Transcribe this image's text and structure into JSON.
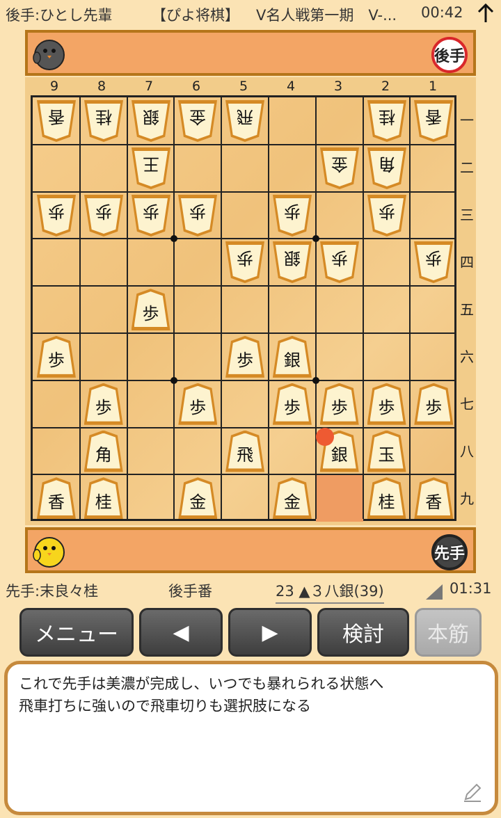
{
  "header": {
    "gote_player": "後手:ひとし先輩",
    "app_name": "【ぴよ将棋】",
    "game_name": "V名人戦第一期　V-...",
    "clock": "00:42"
  },
  "gote_badge": "後手",
  "sente_badge": "先手",
  "file_labels": [
    "9",
    "8",
    "7",
    "6",
    "5",
    "4",
    "3",
    "2",
    "1"
  ],
  "rank_labels": [
    "一",
    "二",
    "三",
    "四",
    "五",
    "六",
    "七",
    "八",
    "九"
  ],
  "board": [
    {
      "file": 9,
      "rank": 1,
      "kanji": "香",
      "owner": "gote"
    },
    {
      "file": 8,
      "rank": 1,
      "kanji": "桂",
      "owner": "gote"
    },
    {
      "file": 7,
      "rank": 1,
      "kanji": "銀",
      "owner": "gote"
    },
    {
      "file": 6,
      "rank": 1,
      "kanji": "金",
      "owner": "gote"
    },
    {
      "file": 5,
      "rank": 1,
      "kanji": "飛",
      "owner": "gote"
    },
    {
      "file": 2,
      "rank": 1,
      "kanji": "桂",
      "owner": "gote"
    },
    {
      "file": 1,
      "rank": 1,
      "kanji": "香",
      "owner": "gote"
    },
    {
      "file": 7,
      "rank": 2,
      "kanji": "王",
      "owner": "gote"
    },
    {
      "file": 3,
      "rank": 2,
      "kanji": "金",
      "owner": "gote"
    },
    {
      "file": 2,
      "rank": 2,
      "kanji": "角",
      "owner": "gote"
    },
    {
      "file": 9,
      "rank": 3,
      "kanji": "歩",
      "owner": "gote"
    },
    {
      "file": 8,
      "rank": 3,
      "kanji": "歩",
      "owner": "gote"
    },
    {
      "file": 7,
      "rank": 3,
      "kanji": "歩",
      "owner": "gote"
    },
    {
      "file": 6,
      "rank": 3,
      "kanji": "歩",
      "owner": "gote"
    },
    {
      "file": 4,
      "rank": 3,
      "kanji": "歩",
      "owner": "gote"
    },
    {
      "file": 2,
      "rank": 3,
      "kanji": "歩",
      "owner": "gote"
    },
    {
      "file": 5,
      "rank": 4,
      "kanji": "歩",
      "owner": "gote"
    },
    {
      "file": 4,
      "rank": 4,
      "kanji": "銀",
      "owner": "gote"
    },
    {
      "file": 3,
      "rank": 4,
      "kanji": "歩",
      "owner": "gote"
    },
    {
      "file": 1,
      "rank": 4,
      "kanji": "歩",
      "owner": "gote"
    },
    {
      "file": 7,
      "rank": 5,
      "kanji": "歩",
      "owner": "sente"
    },
    {
      "file": 9,
      "rank": 6,
      "kanji": "歩",
      "owner": "sente"
    },
    {
      "file": 5,
      "rank": 6,
      "kanji": "歩",
      "owner": "sente"
    },
    {
      "file": 4,
      "rank": 6,
      "kanji": "銀",
      "owner": "sente"
    },
    {
      "file": 8,
      "rank": 7,
      "kanji": "歩",
      "owner": "sente"
    },
    {
      "file": 6,
      "rank": 7,
      "kanji": "歩",
      "owner": "sente"
    },
    {
      "file": 4,
      "rank": 7,
      "kanji": "歩",
      "owner": "sente"
    },
    {
      "file": 3,
      "rank": 7,
      "kanji": "歩",
      "owner": "sente"
    },
    {
      "file": 2,
      "rank": 7,
      "kanji": "歩",
      "owner": "sente"
    },
    {
      "file": 1,
      "rank": 7,
      "kanji": "歩",
      "owner": "sente"
    },
    {
      "file": 8,
      "rank": 8,
      "kanji": "角",
      "owner": "sente"
    },
    {
      "file": 5,
      "rank": 8,
      "kanji": "飛",
      "owner": "sente"
    },
    {
      "file": 3,
      "rank": 8,
      "kanji": "銀",
      "owner": "sente"
    },
    {
      "file": 2,
      "rank": 8,
      "kanji": "玉",
      "owner": "sente"
    },
    {
      "file": 9,
      "rank": 9,
      "kanji": "香",
      "owner": "sente"
    },
    {
      "file": 8,
      "rank": 9,
      "kanji": "桂",
      "owner": "sente"
    },
    {
      "file": 6,
      "rank": 9,
      "kanji": "金",
      "owner": "sente"
    },
    {
      "file": 4,
      "rank": 9,
      "kanji": "金",
      "owner": "sente"
    },
    {
      "file": 2,
      "rank": 9,
      "kanji": "桂",
      "owner": "sente"
    },
    {
      "file": 1,
      "rank": 9,
      "kanji": "香",
      "owner": "sente"
    }
  ],
  "last_move_from": {
    "file": 3,
    "rank": 9
  },
  "last_move_to": {
    "file": 3,
    "rank": 8
  },
  "info": {
    "sente_player": "先手:末良々桂",
    "turn": "後手番",
    "move": "23 ▲３八銀(39)",
    "clock": "01:31"
  },
  "buttons": {
    "menu": "メニュー",
    "prev": "◀",
    "next": "▶",
    "analyze": "検討",
    "mainline": "本筋"
  },
  "comment": {
    "line1": "これで先手は美濃が完成し、いつでも暴れられる状態へ",
    "line2": "飛車打ちに強いので飛車切りも選択肢になる"
  },
  "colors": {
    "background": "#fbe3b4",
    "komadai": "#f3a565",
    "board": "#f2c785",
    "piece_face": "#fdf3cf",
    "piece_edge": "#d58a25",
    "last_move_dot": "#ee5a32"
  },
  "icons": [
    "arrow-up-icon",
    "gote-chick-avatar-icon",
    "sente-chick-avatar-icon",
    "triangle-corner-icon",
    "pencil-icon"
  ]
}
